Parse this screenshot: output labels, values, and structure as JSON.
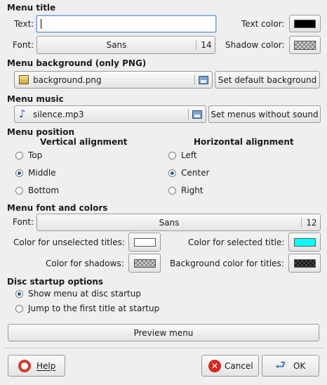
{
  "menu_title": {
    "section": "Menu title",
    "text_label": "Text:",
    "text_value": "",
    "font_label": "Font:",
    "font_name": "Sans",
    "font_size": "14",
    "text_color_label": "Text color:",
    "text_color": "#000000",
    "shadow_color_label": "Shadow color:"
  },
  "menu_background": {
    "section": "Menu background (only PNG)",
    "file": "background.png",
    "set_default_button": "Set default background"
  },
  "menu_music": {
    "section": "Menu music",
    "file": "silence.mp3",
    "no_sound_button": "Set menus without sound"
  },
  "menu_position": {
    "section": "Menu position",
    "vertical_heading": "Vertical alignment",
    "vertical_options": [
      "Top",
      "Middle",
      "Bottom"
    ],
    "vertical_selected": "Middle",
    "horizontal_heading": "Horizontal alignment",
    "horizontal_options": [
      "Left",
      "Center",
      "Right"
    ],
    "horizontal_selected": "Center"
  },
  "menu_font_colors": {
    "section": "Menu font and colors",
    "font_label": "Font:",
    "font_name": "Sans",
    "font_size": "12",
    "unselected_label": "Color for unselected titles:",
    "unselected_color": "#ffffff",
    "selected_label": "Color for selected title:",
    "selected_color": "#00ffff",
    "shadows_label": "Color for shadows:",
    "bg_titles_label": "Background color for titles:"
  },
  "disc_startup": {
    "section": "Disc startup options",
    "options": [
      "Show menu at disc startup",
      "Jump to the first title at startup"
    ],
    "selected": "Show menu at disc startup"
  },
  "preview_button": "Preview menu",
  "footer": {
    "help": "Help",
    "cancel": "Cancel",
    "ok": "OK"
  }
}
